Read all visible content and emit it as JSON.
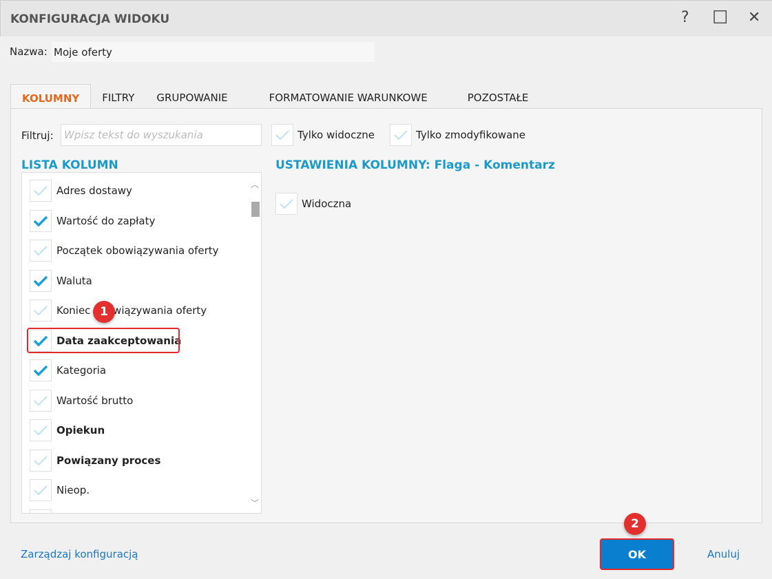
{
  "window": {
    "title": "KONFIGURACJA WIDOKU",
    "help": "?",
    "maximize": "☐",
    "close": "✕"
  },
  "name": {
    "label": "Nazwa:",
    "value": "Moje oferty"
  },
  "tabs": [
    {
      "label": "KOLUMNY",
      "active": true
    },
    {
      "label": "FILTRY"
    },
    {
      "label": "GRUPOWANIE"
    },
    {
      "label": "FORMATOWANIE WARUNKOWE"
    },
    {
      "label": "POZOSTAŁE"
    }
  ],
  "filter": {
    "label": "Filtruj:",
    "placeholder": "Wpisz tekst do wyszukania",
    "only_visible": "Tylko widoczne",
    "only_modified": "Tylko zmodyfikowane"
  },
  "list": {
    "heading": "LISTA KOLUMN",
    "items": [
      {
        "label": "Adres dostawy",
        "checked": false,
        "bold": false
      },
      {
        "label": "Wartość do zapłaty",
        "checked": true,
        "bold": false
      },
      {
        "label": "Początek obowiązywania oferty",
        "checked": false,
        "bold": false
      },
      {
        "label": "Waluta",
        "checked": true,
        "bold": false
      },
      {
        "label": "Koniec obowiązywania oferty",
        "checked": false,
        "bold": false
      },
      {
        "label": "Data zaakceptowania",
        "checked": true,
        "bold": true
      },
      {
        "label": "Kategoria",
        "checked": true,
        "bold": false
      },
      {
        "label": "Wartość brutto",
        "checked": false,
        "bold": false
      },
      {
        "label": "Opiekun",
        "checked": false,
        "bold": true
      },
      {
        "label": "Powiązany proces",
        "checked": false,
        "bold": true
      },
      {
        "label": "Nieop.",
        "checked": false,
        "bold": false
      }
    ]
  },
  "settings": {
    "heading": "USTAWIENIA KOLUMNY: Flaga - Komentarz",
    "visible_label": "Widoczna"
  },
  "footer": {
    "manage": "Zarządzaj konfiguracją",
    "ok": "OK",
    "cancel": "Anuluj"
  },
  "badges": [
    "1",
    "2"
  ],
  "colors": {
    "accent": "#1c9ac9",
    "active_tab": "#e06a22",
    "ok": "#0a7fd0",
    "highlight": "#e32a2a"
  }
}
